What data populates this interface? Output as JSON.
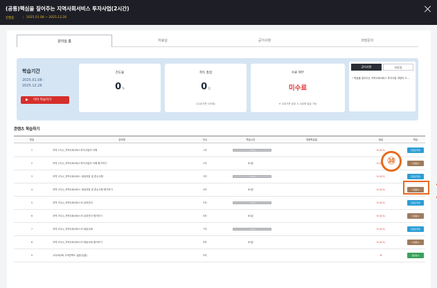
{
  "header": {
    "title": "(공통)핵심을 짚어주는 지역사회서비스 투자사업(2시간)",
    "status": "진행중",
    "period": "2025.01.08 ~ 2025.12.26"
  },
  "tabs": [
    "강의실 홈",
    "자료실",
    "공지사항",
    "과정문의"
  ],
  "summary": {
    "title": "학습기간",
    "date_start": "2025.01.08 -",
    "date_end": "2025.12.26",
    "resume_button": "이어 학습하기",
    "progress_label": "진도율",
    "progress_value": "0",
    "progress_unit": "%",
    "score_label": "취득 총점",
    "score_value": "0",
    "score_unit": "점",
    "score_sub": "/(수료기준 100점)",
    "completion_label": "수료 여부",
    "completion_value": "미수료",
    "completion_sub": "※ 수료기준 달성 시 수료증 발급 가능"
  },
  "notice": {
    "tab_notice": "공지사항",
    "tab_files": "자료실",
    "item": "• 학습을 짚어주는 지역사회서비스 투자사업 과정의 고..."
  },
  "contents": {
    "section_title": "콘텐츠 학습하기",
    "headers": [
      "번호",
      "강의명",
      "차시",
      "학습시간",
      "최종학습일",
      "완료",
      "학습"
    ],
    "rows": [
      {
        "no": "1",
        "name": "지역 1차시_지역사회서비스투자사업의 이해",
        "session": "1차",
        "time": "0/30분",
        "type": "bar",
        "status": "N (0/1)",
        "button": "콘텐츠학습",
        "btn_color": "#2d9dd4"
      },
      {
        "no": "2",
        "name": "지역 1차시_지역사회서비스투자사업의 이해 평가하기",
        "session": "2차",
        "time": "60분",
        "type": "text",
        "status": "N (0/1)",
        "button": "시험응시",
        "btn_color": "#a07a5a"
      },
      {
        "no": "3",
        "name": "지역 2차시_지역사회서비스 제공과정 및 준수사항",
        "session": "3차",
        "time": "0/30분",
        "type": "bar",
        "status": "N (0/1)",
        "button": "콘텐츠학습",
        "btn_color": "#2d9dd4"
      },
      {
        "no": "4",
        "name": "지역 2차시_지역사회서비스 제공과정 및 준수사항 평가하기",
        "session": "4차",
        "time": "60분",
        "type": "text",
        "status": "N (0/1)",
        "button": "시험응시",
        "btn_color": "#a07a5a"
      },
      {
        "no": "5",
        "name": "지역 3차시_지역사회서비스의 성과관리",
        "session": "5차",
        "time": "0/30분",
        "type": "bar",
        "status": "N (0/1)",
        "button": "콘텐츠학습",
        "btn_color": "#2d9dd4"
      },
      {
        "no": "6",
        "name": "지역 3차시_지역사회서비스의 성과관리 평가하기",
        "session": "6차",
        "time": "60분",
        "type": "text",
        "status": "N (0/1)",
        "button": "시험응시",
        "btn_color": "#a07a5a"
      },
      {
        "no": "7",
        "name": "지역 4차시_지역사회서비스의 제공사례",
        "session": "7차",
        "time": "0/30분",
        "type": "bar",
        "status": "N (0/1)",
        "button": "콘텐츠학습",
        "btn_color": "#2d9dd4"
      },
      {
        "no": "8",
        "name": "지역 4차시_지역사회서비스의 제공사례 평가하기",
        "session": "8차",
        "time": "60분",
        "type": "text",
        "status": "N (0/1)",
        "button": "시험응시",
        "btn_color": "#a07a5a"
      },
      {
        "no": "9",
        "name": "사이버교육 고객만족도 설문(공통)",
        "session": "9차",
        "time": "",
        "type": "text",
        "status": "N",
        "button": "설문응시",
        "btn_color": "#3aa15c"
      }
    ]
  },
  "annotation": {
    "number": "⑩",
    "arrow": "〉"
  }
}
